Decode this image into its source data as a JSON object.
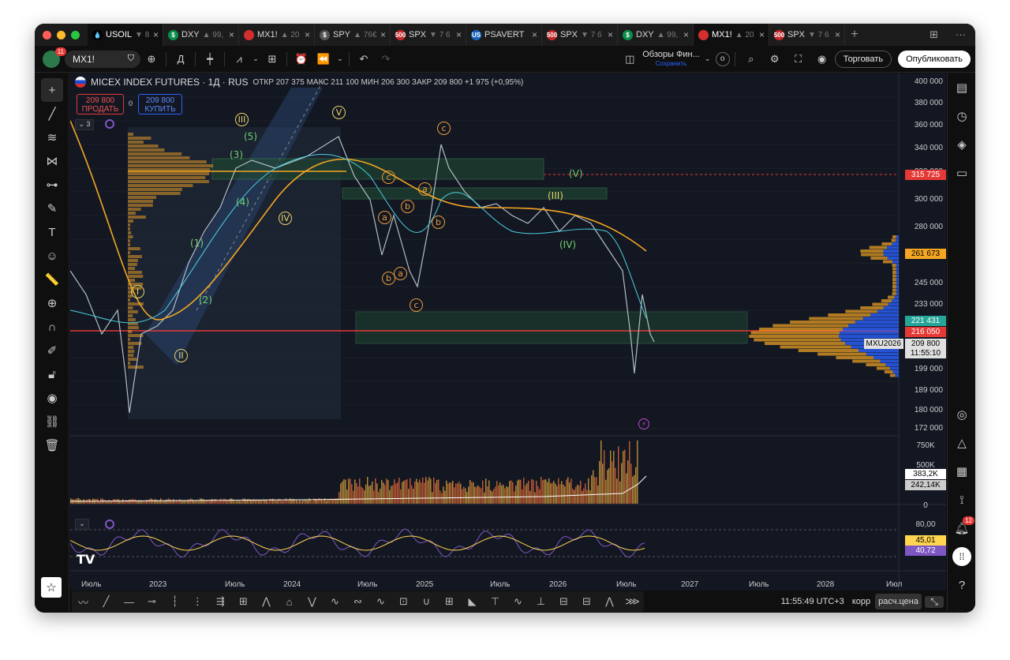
{
  "tabs": [
    {
      "label": "USOIL",
      "chg": "▼ 8",
      "icon": "💧",
      "color": "#000",
      "active": true
    },
    {
      "label": "DXY",
      "chg": "▲ 99,",
      "icon": "$",
      "color": "#0b8e4b"
    },
    {
      "label": "MX1!",
      "chg": "▲ 20",
      "icon": "",
      "color": "#d32f2f"
    },
    {
      "label": "SPY",
      "chg": "▲ 76€",
      "icon": "$",
      "color": "#555"
    },
    {
      "label": "SPX",
      "chg": "▼ 7 6",
      "icon": "500",
      "color": "#c62828"
    },
    {
      "label": "PSAVERT",
      "chg": "",
      "icon": "US",
      "color": "#1565c0"
    },
    {
      "label": "SPX",
      "chg": "▼ 7 6",
      "icon": "500",
      "color": "#c62828"
    },
    {
      "label": "DXY",
      "chg": "▲ 99,",
      "icon": "$",
      "color": "#0b8e4b"
    },
    {
      "label": "MX1!",
      "chg": "▲ 20",
      "icon": "",
      "color": "#d32f2f",
      "active2": true
    },
    {
      "label": "SPX",
      "chg": "▼ 7 6",
      "icon": "500",
      "color": "#c62828"
    }
  ],
  "toolbar": {
    "avatar_badge": "11",
    "symbol": "MX1!",
    "interval": "Д",
    "layout_name": "Обзоры Фин...",
    "layout_sub": "Сохранить",
    "o_label": "o",
    "trade_label": "Торговать",
    "publish_label": "Опубликовать"
  },
  "header": {
    "title": "MICEX INDEX FUTURES · 1Д · RUS",
    "ohlc": "ОТКР 207 375  МАКС 211 100  МИН 206 300  ЗАКР 209 800  +1 975 (+0,95%)",
    "sell_price": "209 800",
    "sell_label": "ПРОДАТЬ",
    "spread": "0",
    "buy_price": "209 800",
    "buy_label": "КУПИТЬ",
    "indicators_count": "3"
  },
  "price_axis": [
    "400 000",
    "380 000",
    "360 000",
    "340 000",
    "320 000",
    "300 000",
    "280 000",
    "261 673",
    "245 000",
    "233 000",
    "221 431",
    "216 050",
    "209 800",
    "199 000",
    "189 000",
    "180 000",
    "172 000"
  ],
  "price_tags": {
    "red_line": "315 725",
    "orange": "261 673",
    "teal": "221 431",
    "red": "216 050",
    "current": "209 800",
    "countdown": "11:55:10",
    "symbol_tag": "MXU2026"
  },
  "volume_axis": [
    "750K",
    "500K",
    "383,2K",
    "242,14K",
    "0"
  ],
  "rsi_axis": [
    "80,00",
    "45,01",
    "40,72"
  ],
  "x_axis": [
    "Июль",
    "2023",
    "Июль",
    "2024",
    "Июль",
    "2025",
    "Июль",
    "2026",
    "Июль",
    "2027",
    "Июль",
    "2028",
    "Июл"
  ],
  "wave_labels": [
    {
      "t": "I",
      "c": "y"
    },
    {
      "t": "II",
      "c": "y"
    },
    {
      "t": "III",
      "c": "y"
    },
    {
      "t": "IV",
      "c": "y"
    },
    {
      "t": "V",
      "c": "y"
    },
    {
      "t": "(1)",
      "c": "g"
    },
    {
      "t": "(2)",
      "c": "g"
    },
    {
      "t": "(3)",
      "c": "g"
    },
    {
      "t": "(4)",
      "c": "g"
    },
    {
      "t": "(5)",
      "c": "g"
    },
    {
      "t": "a",
      "c": "o"
    },
    {
      "t": "b",
      "c": "o"
    },
    {
      "t": "c",
      "c": "o"
    },
    {
      "t": "a",
      "c": "o"
    },
    {
      "t": "b",
      "c": "o"
    },
    {
      "t": "c",
      "c": "o"
    },
    {
      "t": "a",
      "c": "o"
    },
    {
      "t": "b",
      "c": "o"
    },
    {
      "t": "c",
      "c": "o"
    },
    {
      "t": "(V)",
      "c": "g"
    },
    {
      "t": "(IV)",
      "c": "g"
    },
    {
      "t": "(III)",
      "c": "y"
    }
  ],
  "bottom": {
    "time": "11:55:49 UTC+3",
    "corr": "корр",
    "calc": "расч.цена"
  },
  "right_badge": "12",
  "colors": {
    "up": "#26a69a",
    "down": "#ef5350",
    "orange": "#f5a623",
    "blue": "#2962ff"
  }
}
